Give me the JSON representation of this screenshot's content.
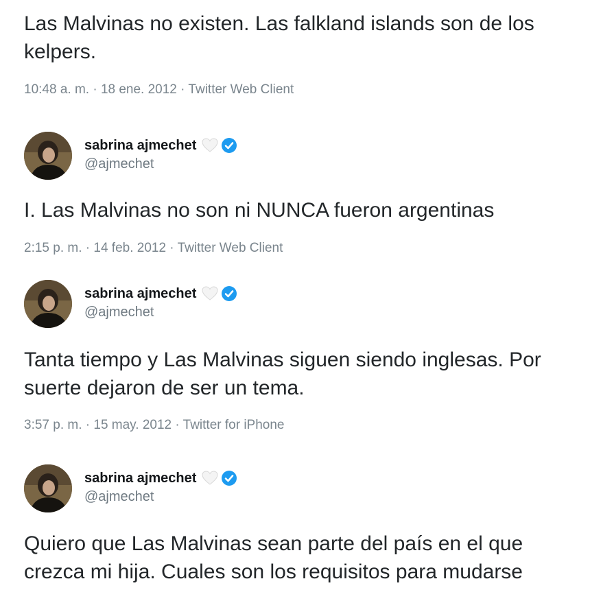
{
  "tweets": [
    {
      "text": "Las Malvinas no existen. Las falkland islands son de los kelpers.",
      "meta": "10:48 a. m. · 18 ene. 2012 · Twitter Web Client"
    },
    {
      "display_name": "sabrina ajmechet",
      "handle": "@ajmechet",
      "text": "I. Las Malvinas no son ni NUNCA fueron argentinas",
      "meta": "2:15 p. m. · 14 feb. 2012 · Twitter Web Client"
    },
    {
      "display_name": "sabrina ajmechet",
      "handle": "@ajmechet",
      "text": "Tanta tiempo y Las Malvinas siguen siendo inglesas. Por suerte dejaron de ser un tema.",
      "meta": "3:57 p. m. · 15 may. 2012 · Twitter for iPhone"
    },
    {
      "display_name": "sabrina ajmechet",
      "handle": "@ajmechet",
      "text": "Quiero que Las Malvinas sean parte del país en el que crezca mi hija. Cuales son los requisitos para mudarse"
    }
  ],
  "icons": {
    "heart": "white-heart-icon",
    "verified": "verified-badge-icon"
  },
  "colors": {
    "verified": "#1d9bf0",
    "meta_text": "#7a858d"
  }
}
